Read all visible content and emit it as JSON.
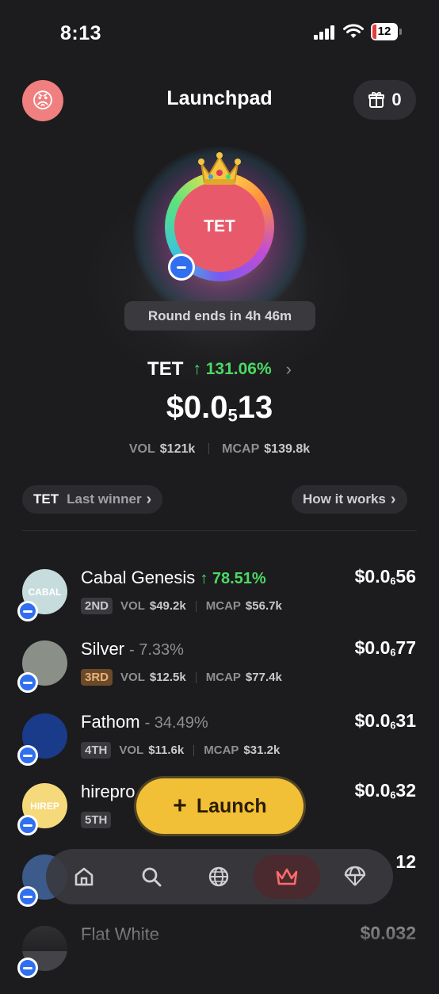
{
  "status": {
    "time": "8:13",
    "battery": "12"
  },
  "header": {
    "avatar_emoji": "😡",
    "title": "Launchpad",
    "gift_count": "0"
  },
  "hero": {
    "token_label": "TET",
    "round_text": "Round ends in 4h 46m",
    "symbol": "TET",
    "change": "↑ 131.06%",
    "price_main": "$0.0",
    "price_sub": "5",
    "price_tail": "13",
    "vol_label": "VOL",
    "vol": "$121k",
    "mcap_label": "MCAP",
    "mcap": "$139.8k"
  },
  "last_winner": {
    "symbol": "TET",
    "label": "Last winner"
  },
  "how_it_works": "How it works",
  "tokens": [
    {
      "avatar_text": "CABAL",
      "avatar_color": "#c7dcdc",
      "name": "Cabal Genesis",
      "change": "↑ 78.51%",
      "direction": "up",
      "rank": "2ND",
      "rank_color": "#3a3a3e",
      "rank_text_color": "#c9c9ce",
      "vol": "$49.2k",
      "mcap": "$56.7k",
      "price_main": "$0.0",
      "price_sub": "6",
      "price_tail": "56"
    },
    {
      "avatar_text": "",
      "avatar_color": "#8a8f88",
      "name": "Silver",
      "change": "- 7.33%",
      "direction": "down",
      "rank": "3RD",
      "rank_color": "#6b4a2a",
      "rank_text_color": "#e9b27a",
      "vol": "$12.5k",
      "mcap": "$77.4k",
      "price_main": "$0.0",
      "price_sub": "6",
      "price_tail": "77"
    },
    {
      "avatar_text": "",
      "avatar_color": "#1a3a8a",
      "name": "Fathom",
      "change": "- 34.49%",
      "direction": "down",
      "rank": "4TH",
      "rank_color": "#3a3a3e",
      "rank_text_color": "#c9c9ce",
      "vol": "$11.6k",
      "mcap": "$31.2k",
      "price_main": "$0.0",
      "price_sub": "6",
      "price_tail": "31"
    },
    {
      "avatar_text": "HIREP",
      "avatar_color": "#f5d97a",
      "name": "hirepro",
      "change": "",
      "direction": "down",
      "rank": "5TH",
      "rank_color": "#3a3a3e",
      "rank_text_color": "#c9c9ce",
      "vol": "",
      "mcap": "",
      "price_main": "$0.0",
      "price_sub": "6",
      "price_tail": "32"
    },
    {
      "avatar_text": "",
      "avatar_color": "#3c5a8a",
      "name": "",
      "change": "",
      "direction": "down",
      "rank": "",
      "rank_color": "#3a3a3e",
      "rank_text_color": "#c9c9ce",
      "vol": "",
      "mcap": "",
      "price_main": "",
      "price_sub": "",
      "price_tail": "12"
    },
    {
      "avatar_text": "",
      "avatar_color": "#444448",
      "name": "Flat White",
      "change": "",
      "direction": "down",
      "rank": "",
      "rank_color": "#3a3a3e",
      "rank_text_color": "#c9c9ce",
      "vol": "",
      "mcap": "",
      "price_main": "$0.0",
      "price_sub": "",
      "price_tail": "32"
    }
  ],
  "labels": {
    "vol": "VOL",
    "mcap": "MCAP"
  },
  "launch_button": "Launch",
  "nav": [
    {
      "icon": "home-icon",
      "active": false
    },
    {
      "icon": "search-icon",
      "active": false
    },
    {
      "icon": "globe-icon",
      "active": false
    },
    {
      "icon": "crown-icon",
      "active": true
    },
    {
      "icon": "parachute-icon",
      "active": false
    }
  ],
  "colors": {
    "accent_yellow": "#f2c037",
    "up_green": "#4cd964",
    "hero_red": "#e85a6b",
    "chain_blue": "#2f6ff0"
  }
}
